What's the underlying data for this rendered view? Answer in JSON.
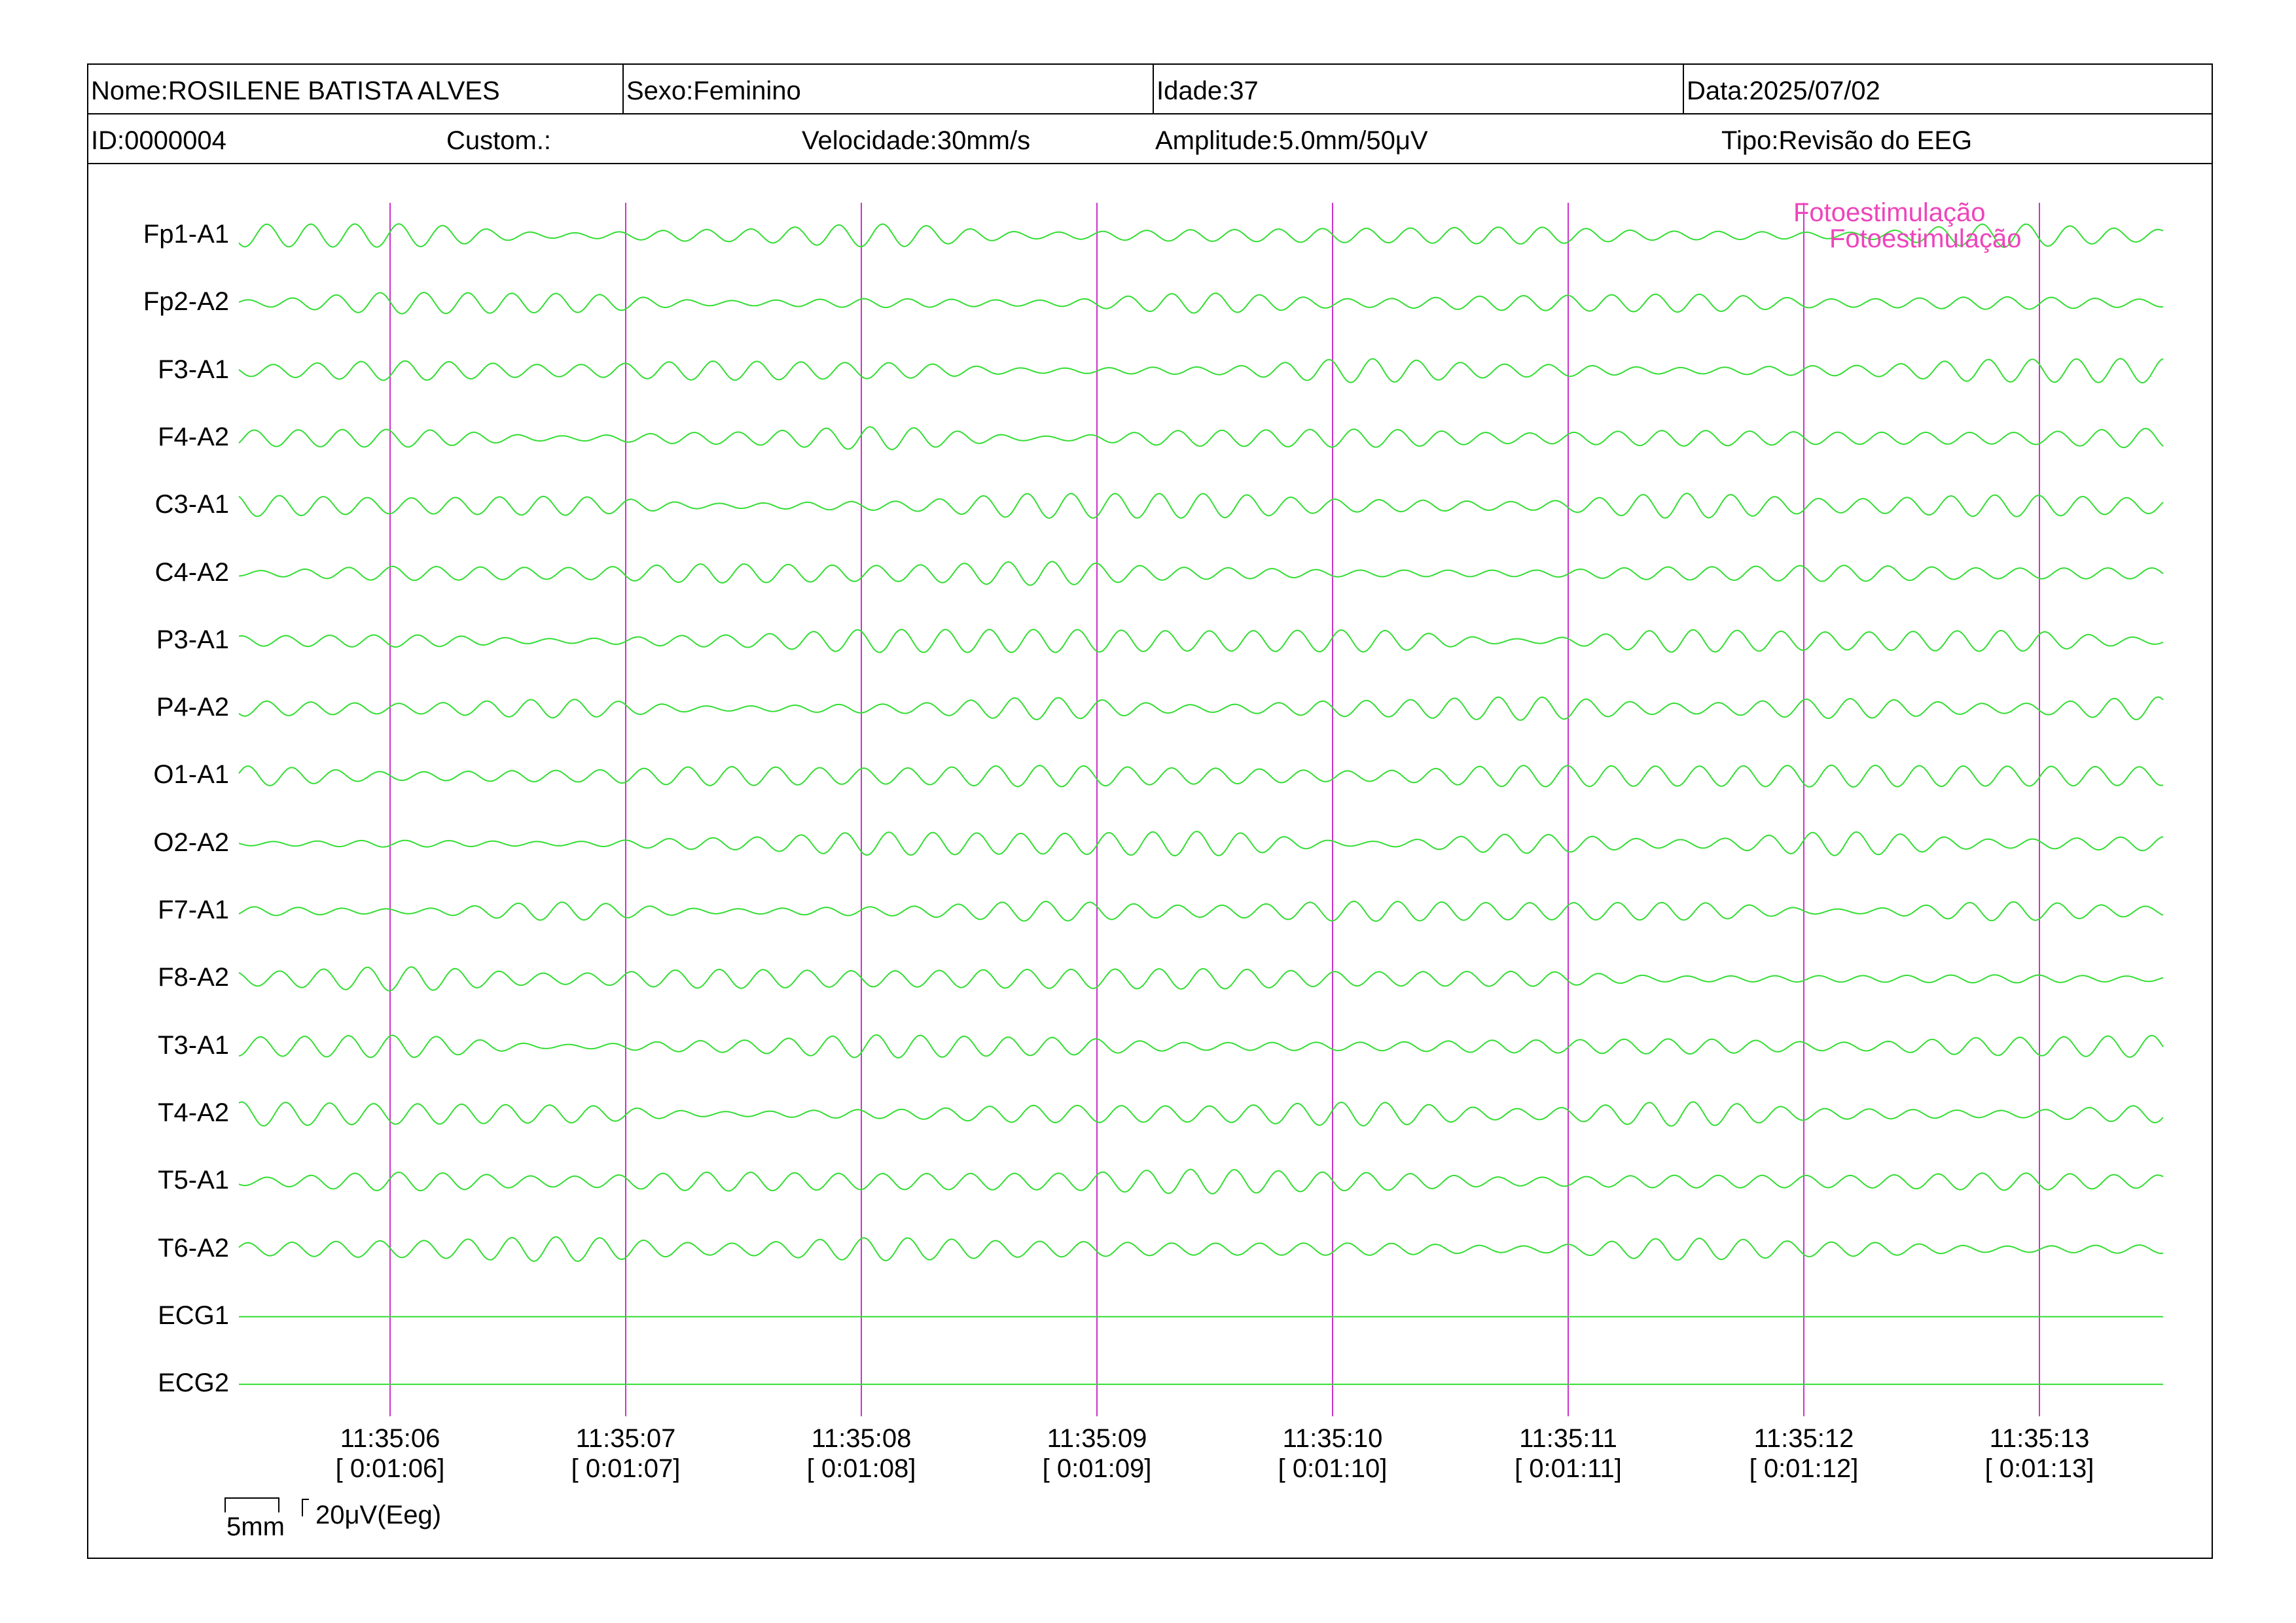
{
  "header": {
    "nome": "Nome:ROSILENE BATISTA ALVES",
    "sexo": "Sexo:Feminino",
    "idade": "Idade:37",
    "data": "Data:2025/07/02",
    "id": "ID:0000004",
    "custom": "Custom.:",
    "velocidade": "Velocidade:30mm/s",
    "amplitude": "Amplitude:5.0mm/50μV",
    "tipo": "Tipo:Revisão do EEG"
  },
  "chart_data": {
    "type": "line",
    "channels": [
      "Fp1-A1",
      "Fp2-A2",
      "F3-A1",
      "F4-A2",
      "C3-A1",
      "C4-A2",
      "P3-A1",
      "P4-A2",
      "O1-A1",
      "O2-A2",
      "F7-A1",
      "F8-A2",
      "T3-A1",
      "T4-A2",
      "T5-A1",
      "T6-A2",
      "ECG1",
      "ECG2"
    ],
    "time_markers": [
      {
        "clock": "11:35:06",
        "elapsed": "[ 0:01:06]"
      },
      {
        "clock": "11:35:07",
        "elapsed": "[ 0:01:07]"
      },
      {
        "clock": "11:35:08",
        "elapsed": "[ 0:01:08]"
      },
      {
        "clock": "11:35:09",
        "elapsed": "[ 0:01:09]"
      },
      {
        "clock": "11:35:10",
        "elapsed": "[ 0:01:10]"
      },
      {
        "clock": "11:35:11",
        "elapsed": "[ 0:01:11]"
      },
      {
        "clock": "11:35:12",
        "elapsed": "[ 0:01:12]"
      },
      {
        "clock": "11:35:13",
        "elapsed": "[ 0:01:13]"
      }
    ],
    "events": [
      {
        "label": "Fotoestimulação"
      },
      {
        "label": "Fotoestimulação"
      }
    ],
    "trace_color": "#33dd33",
    "marker_color": "#cc33cc",
    "event_color": "#ee44bb"
  },
  "scale": {
    "time_label": "5mm",
    "amplitude_label": "20μV(Eeg)"
  }
}
